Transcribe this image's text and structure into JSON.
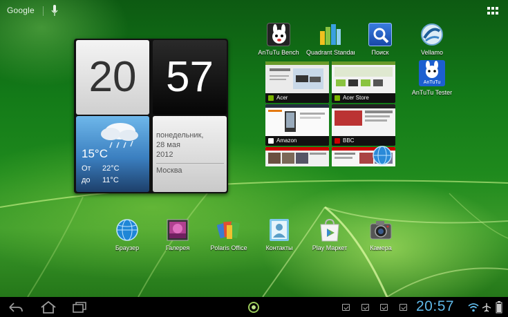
{
  "topbar": {
    "search_label": "Google",
    "icons": {
      "mic": "mic-icon",
      "apps": "all-apps-icon"
    }
  },
  "clock_widget": {
    "hour": "20",
    "minute": "57",
    "weather": {
      "temp_now": "15°C",
      "from_label": "От",
      "from_value": "22°C",
      "to_label": "до",
      "to_value": "11°C",
      "condition_icon": "cloud-rain-icon"
    },
    "date": {
      "weekday": "понедельник,",
      "day_month": "28 мая",
      "year": "2012",
      "city": "Москва"
    }
  },
  "top_apps": [
    {
      "label": "AnTuTu Bench",
      "icon": "antutu-bench-icon"
    },
    {
      "label": "Quadrant Standard",
      "icon": "quadrant-icon"
    },
    {
      "label": "Поиск",
      "icon": "search-icon"
    },
    {
      "label": "Vellamo",
      "icon": "vellamo-icon"
    },
    {
      "label": "AnTuTu Tester",
      "icon": "antutu-tester-icon"
    }
  ],
  "bookmarks": [
    {
      "title": "Acer",
      "fav_color": "#79b300"
    },
    {
      "title": "Acer Store",
      "fav_color": "#79b300"
    },
    {
      "title": "Amazon",
      "fav_color": "#ffffff"
    },
    {
      "title": "BBC",
      "fav_color": "#cc0000"
    },
    {
      "title": "",
      "fav_color": "#cc0000"
    },
    {
      "title": "",
      "fav_color": "#ffffff"
    }
  ],
  "dock_apps": [
    {
      "label": "Браузер",
      "icon": "browser-globe-icon"
    },
    {
      "label": "Галерея",
      "icon": "gallery-icon"
    },
    {
      "label": "Polaris Office",
      "icon": "polaris-office-icon"
    },
    {
      "label": "Контакты",
      "icon": "contacts-icon"
    },
    {
      "label": "Play Маркет",
      "icon": "play-store-icon"
    },
    {
      "label": "Камера",
      "icon": "camera-icon"
    }
  ],
  "statusbar": {
    "time": "20:57",
    "nav_icons": [
      "back-icon",
      "home-icon",
      "recent-apps-icon"
    ],
    "status_icons": [
      "wifi-icon",
      "airplane-icon",
      "battery-icon"
    ],
    "accent": "#5fb8e8"
  }
}
